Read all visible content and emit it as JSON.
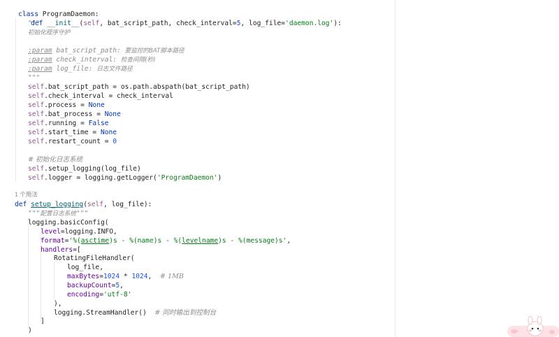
{
  "code": {
    "class_kw": "class",
    "class_name": "ProgramDaemon:",
    "def_kw": "def",
    "init_name": "__init__",
    "init_params_a": "(",
    "self": "self",
    "init_params_b": ", bat_script_path, check_interval=",
    "check_interval_default": "5",
    "init_params_c": ", log_file=",
    "log_file_default": "'daemon.log'",
    "init_params_d": "):",
    "doc_open": "\"\"\"",
    "doc_summary": "初始化程序守护",
    "param_tag": ":param",
    "param1_name": " bat_script_path: ",
    "param1_desc": "要监控的BAT脚本路径",
    "param2_name": " check_interval: ",
    "param2_desc": "检查间隔(秒)",
    "param3_name": " log_file: ",
    "param3_desc": "日志文件路径",
    "doc_close": "\"\"\"",
    "l_bat_path": ".bat_script_path = os.path.abspath(bat_script_path)",
    "l_check_interval": ".check_interval = check_interval",
    "l_process": ".process = ",
    "l_bat_process": ".bat_process = ",
    "none_kw": "None",
    "l_running": ".running = ",
    "false_kw": "False",
    "l_start_time": ".start_time = ",
    "l_restart_count": ".restart_count = ",
    "zero": "0",
    "comment_init_log": "# 初始化日志系统",
    "l_setup_call": ".setup_logging(log_file)",
    "l_logger_a": ".logger = logging.getLogger(",
    "logger_name": "'ProgramDaemon'",
    "l_logger_b": ")",
    "usage_hint": "1 个用法",
    "setup_name": "setup_logging",
    "setup_params_b": ", log_file):",
    "setup_doc_open": "\"\"\"",
    "setup_doc_text": "配置日志系统",
    "setup_doc_close": "\"\"\"",
    "basic_config": "logging.basicConfig(",
    "level_kw": "level",
    "level_val": "=logging.INFO,",
    "format_kw": "format",
    "format_eq": "=",
    "format_str_a": "'%(",
    "asctime": "asctime",
    "format_str_b": ")s - %(name)s - %(",
    "levelname": "levelname",
    "format_str_c": ")s - %(message)s'",
    "format_comma": ",",
    "handlers_kw": "handlers",
    "handlers_eq": "=[",
    "rfh": "RotatingFileHandler(",
    "rfh_logfile": "log_file,",
    "maxbytes_kw": "maxBytes",
    "maxbytes_eq": "=",
    "n1024a": "1024",
    "times": " * ",
    "n1024b": "1024",
    "maxbytes_comma": ",  ",
    "maxbytes_comment": "# 1MB",
    "backup_kw": "backupCount",
    "backup_eq": "=",
    "backup_val": "5",
    "backup_comma": ",",
    "encoding_kw": "encoding",
    "encoding_eq": "=",
    "encoding_val": "'utf-8'",
    "rfh_close": "),",
    "stream_handler": "logging.StreamHandler()  ",
    "stream_comment": "# 同时输出到控制台",
    "list_close": "]",
    "call_close": ")"
  }
}
